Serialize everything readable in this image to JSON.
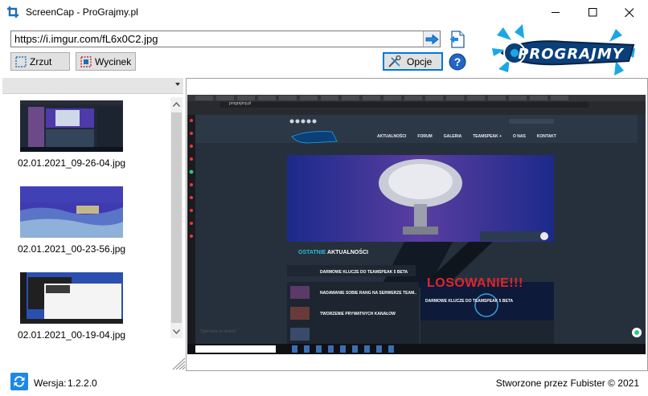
{
  "window": {
    "title": "ScreenCap - ProGrajmy.pl",
    "minimize_icon": "minimize-icon",
    "maximize_icon": "maximize-icon",
    "close_icon": "close-icon"
  },
  "url_bar": {
    "value": "https://i.imgur.com/fL6x0C2.jpg",
    "go_icon": "arrow-right-icon",
    "doc_icon": "document-icon"
  },
  "toolbar": {
    "zrzut_label": "Zrzut",
    "wycinek_label": "Wycinek",
    "opcje_label": "Opcje",
    "help_icon": "help-icon"
  },
  "logo": {
    "text": "PROGRAJMY"
  },
  "history": {
    "combo_value": "",
    "items": [
      {
        "label": "02.01.2021_09-26-04.jpg"
      },
      {
        "label": "02.01.2021_00-23-56.jpg"
      },
      {
        "label": "02.01.2021_00-19-04.jpg"
      }
    ]
  },
  "preview": {
    "site": {
      "address": "prograjmy.pl",
      "nav": [
        "AKTUALNOŚCI",
        "FORUM",
        "GALERIA",
        "TEAMSPEAK +",
        "O NAS",
        "KONTAKT"
      ],
      "section_title_a": "OSTATNIE",
      "section_title_b": "AKTUALNOŚCI",
      "posts": [
        "DARMOWE KLUCZE DO TEAMSPEAK 5 BETA",
        "NADAWANIE SOBIE RANG NA SERWERZE TEAM...",
        "TWORZENIE PRYWATNYCH KANAŁÓW"
      ],
      "banner_text": "LOSOWANIE!!!",
      "feature_title": "DARMOWE KLUCZE DO TEAMSPEAK 5 BETA",
      "taskbar_search": "Type here to search"
    }
  },
  "footer": {
    "version_label": "Wersja:",
    "version_value": "1.2.2.0",
    "credit": "Stworzone przez Fubister © 2021"
  },
  "colors": {
    "accent_blue": "#0078d7",
    "site_cyan": "#2fb8d8",
    "banner_red": "#e0262b"
  }
}
